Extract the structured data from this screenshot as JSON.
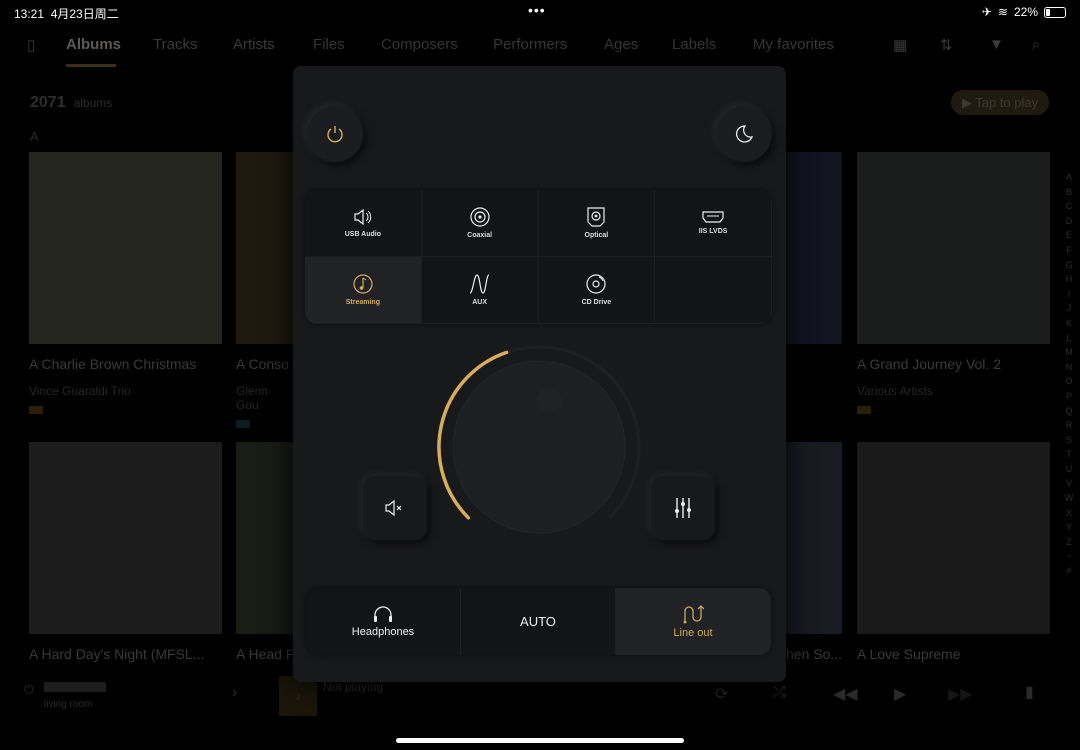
{
  "status": {
    "time": "13:21",
    "date": "4月23日周二",
    "battery": "22%",
    "battery_level": 0.22
  },
  "nav": {
    "tabs": [
      "Albums",
      "Tracks",
      "Artists",
      "Files",
      "Composers",
      "Performers",
      "Ages",
      "Labels",
      "My favorites"
    ],
    "active": "Albums"
  },
  "library": {
    "count": "2071",
    "count_label": "albums",
    "section_letter": "A",
    "tap_to_play": "▶ Tap to play",
    "albums": [
      {
        "title": "A Charlie Brown Christmas",
        "artist": "Vince Guaraldi Trio"
      },
      {
        "title": "A Conso",
        "artist": "Glenn Gou"
      },
      {
        "title": "A Grand Journey Vol. 2",
        "artist": "Various Artists"
      },
      {
        "title": "A Hard Day's Night  (MFSL...",
        "artist": ""
      },
      {
        "title": "A Head F",
        "artist": ""
      },
      {
        "title": "hen So...",
        "artist": ""
      },
      {
        "title": "A Love Supreme",
        "artist": ""
      }
    ],
    "alphabet": [
      "A",
      "B",
      "C",
      "D",
      "E",
      "F",
      "G",
      "H",
      "I",
      "J",
      "K",
      "L",
      "M",
      "N",
      "O",
      "P",
      "Q",
      "R",
      "S",
      "T",
      "U",
      "V",
      "W",
      "X",
      "Y",
      "Z",
      "~",
      "#"
    ]
  },
  "player": {
    "zone": "living room",
    "now_playing": "Not playing"
  },
  "control": {
    "inputs": [
      {
        "label": "USB Audio",
        "icon": "usb-audio-icon"
      },
      {
        "label": "Coaxial",
        "icon": "coaxial-icon"
      },
      {
        "label": "Optical",
        "icon": "optical-icon"
      },
      {
        "label": "IIS LVDS",
        "icon": "hdmi-icon"
      },
      {
        "label": "Streaming",
        "icon": "music-note-icon",
        "selected": true
      },
      {
        "label": "AUX",
        "icon": "wave-icon"
      },
      {
        "label": "CD Drive",
        "icon": "disc-icon"
      }
    ],
    "volume_level": 0.43,
    "outputs": [
      {
        "label": "Headphones"
      },
      {
        "label": "AUTO"
      },
      {
        "label": "Line out",
        "selected": true
      }
    ],
    "accent": "#d7ac5b"
  }
}
